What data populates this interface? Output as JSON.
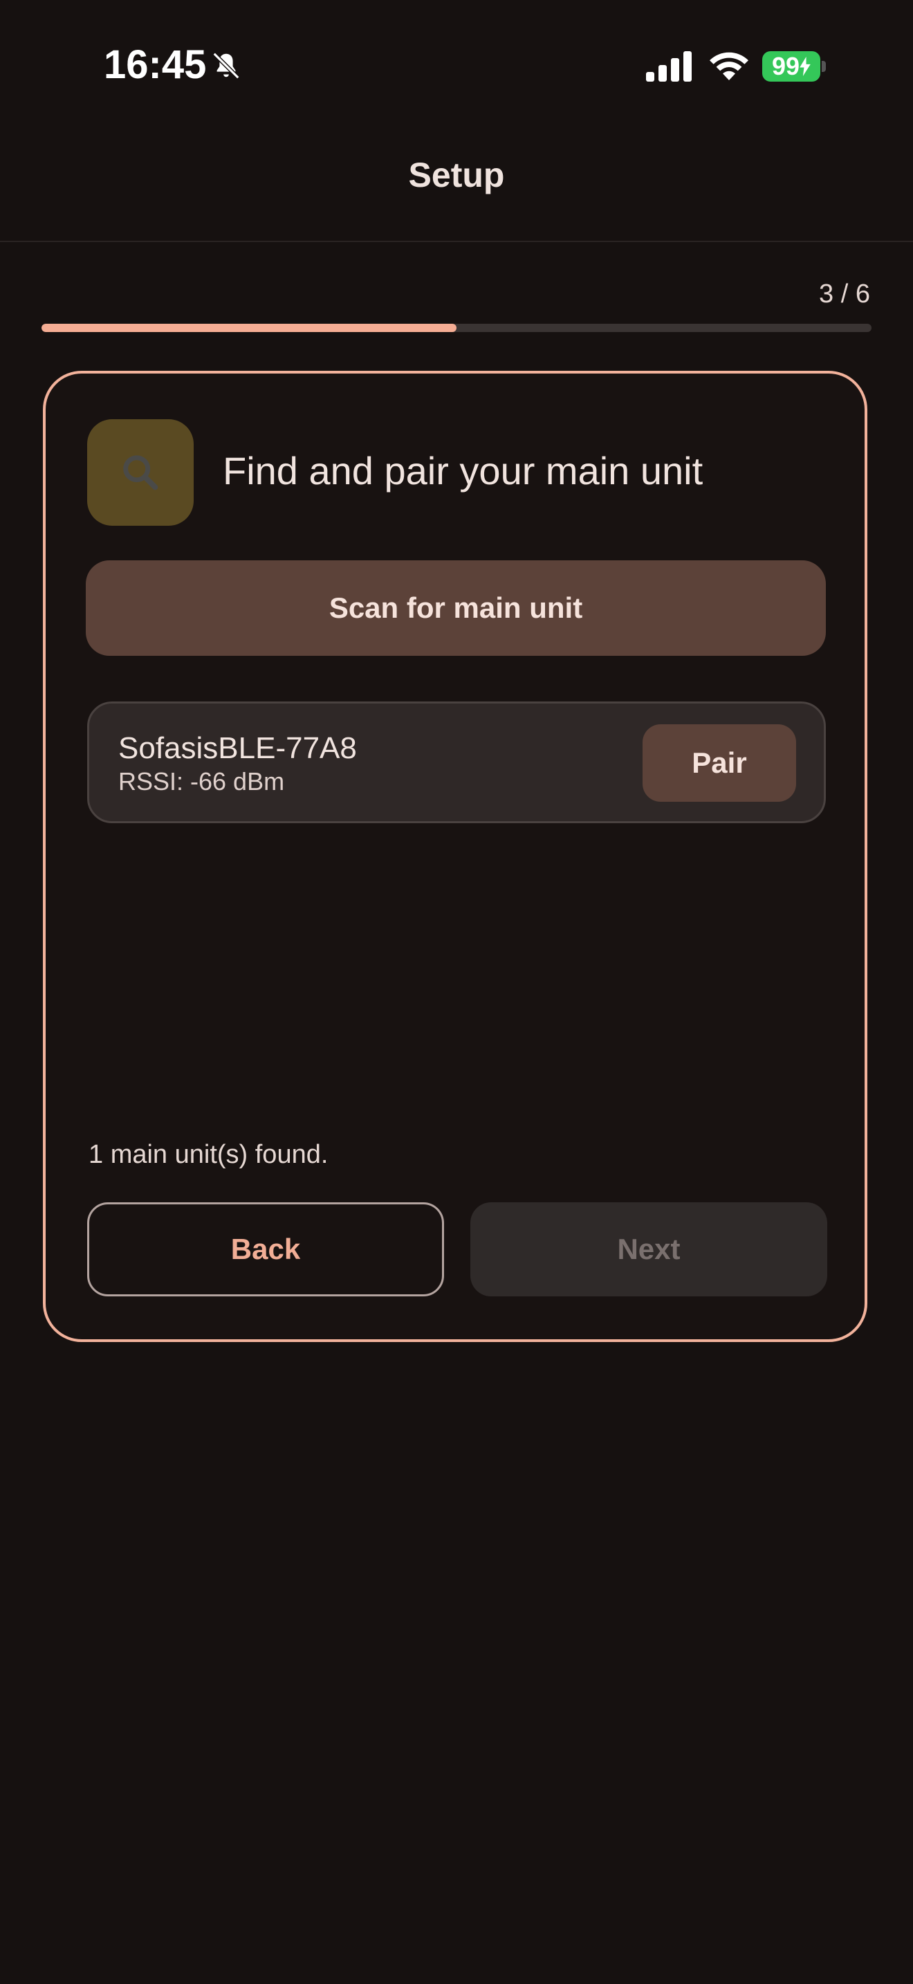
{
  "status_bar": {
    "time": "16:45",
    "battery_level": "99",
    "battery_color": "#34c759"
  },
  "header": {
    "title": "Setup"
  },
  "progress": {
    "label": "3 / 6",
    "current_step": 3,
    "total_steps": 6,
    "fraction": 0.5,
    "accent_color": "#f5ad94"
  },
  "step": {
    "icon": "search-icon",
    "title": "Find and pair your main unit",
    "scan_label": "Scan for main unit"
  },
  "devices": [
    {
      "name": "SofasisBLE-77A8",
      "rssi": "RSSI: -66 dBm",
      "pair_label": "Pair"
    }
  ],
  "found_text": "1 main unit(s) found.",
  "navigation": {
    "back_label": "Back",
    "next_label": "Next"
  }
}
